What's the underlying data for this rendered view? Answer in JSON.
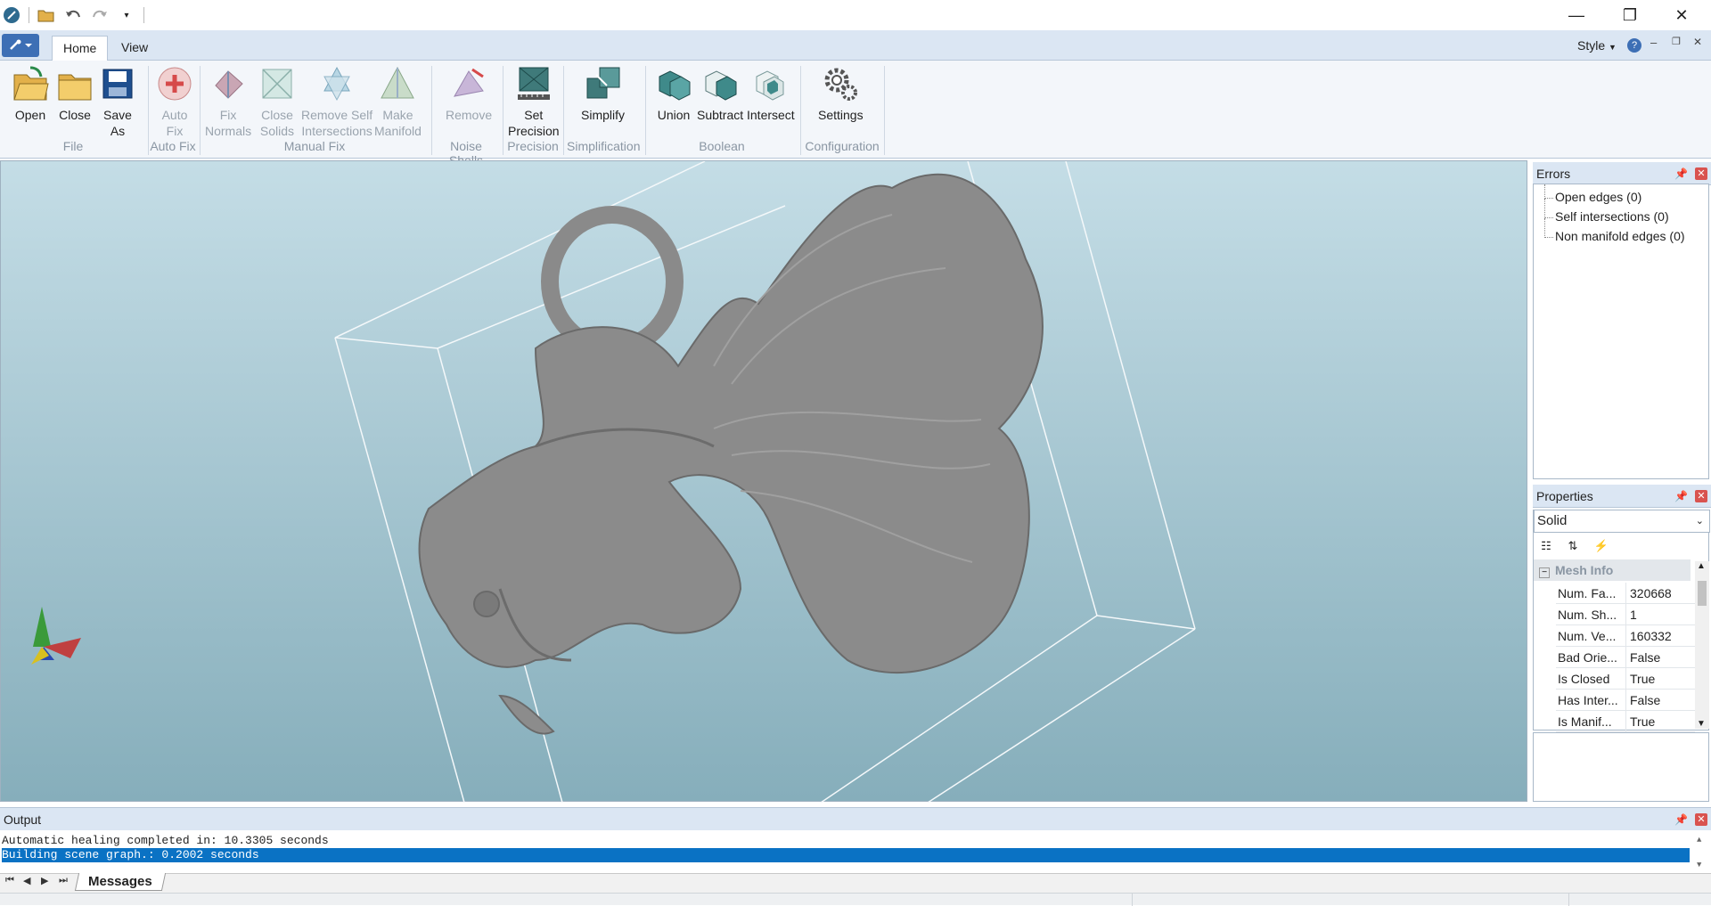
{
  "window": {
    "minimize": "—",
    "maximize": "❐",
    "close": "✕"
  },
  "ribbon": {
    "tabs": [
      "Home",
      "View"
    ],
    "style_label": "Style",
    "buttons": {
      "open": "Open",
      "close": "Close",
      "save_as_1": "Save",
      "save_as_2": "As",
      "auto_fix_1": "Auto",
      "auto_fix_2": "Fix",
      "fix_normals_1": "Fix",
      "fix_normals_2": "Normals",
      "close_solids_1": "Close",
      "close_solids_2": "Solids",
      "remove_self_1": "Remove Self",
      "remove_self_2": "Intersections",
      "make_manifold_1": "Make",
      "make_manifold_2": "Manifold",
      "remove": "Remove",
      "set_precision_1": "Set",
      "set_precision_2": "Precision",
      "simplify": "Simplify",
      "union": "Union",
      "subtract": "Subtract",
      "intersect": "Intersect",
      "settings": "Settings"
    },
    "groups": {
      "file": "File",
      "auto_fix": "Auto Fix",
      "manual_fix": "Manual Fix",
      "noise_shells": "Noise Shells",
      "precision": "Precision",
      "simplification": "Simplification",
      "boolean": "Boolean",
      "configuration": "Configuration"
    }
  },
  "errors": {
    "title": "Errors",
    "items": [
      "Open edges (0)",
      "Self intersections (0)",
      "Non manifold edges (0)"
    ]
  },
  "properties": {
    "title": "Properties",
    "selected": "Solid",
    "category": "Mesh Info",
    "rows": [
      {
        "k": "Num. Fa...",
        "v": "320668"
      },
      {
        "k": "Num. Sh...",
        "v": "1"
      },
      {
        "k": "Num. Ve...",
        "v": "160332"
      },
      {
        "k": "Bad Orie...",
        "v": "False"
      },
      {
        "k": "Is Closed",
        "v": "True"
      },
      {
        "k": "Has Inter...",
        "v": "False"
      },
      {
        "k": "Is Manif...",
        "v": "True"
      }
    ]
  },
  "output": {
    "title": "Output",
    "lines": [
      "Automatic healing completed in: 10.3305 seconds",
      "Building scene graph.: 0.2002 seconds"
    ],
    "tab": "Messages"
  },
  "colors": {
    "accent": "#0a72c4",
    "ribbon_bg": "#f3f6fa",
    "viewport_top": "#c4dde6",
    "viewport_bottom": "#86aebb"
  }
}
